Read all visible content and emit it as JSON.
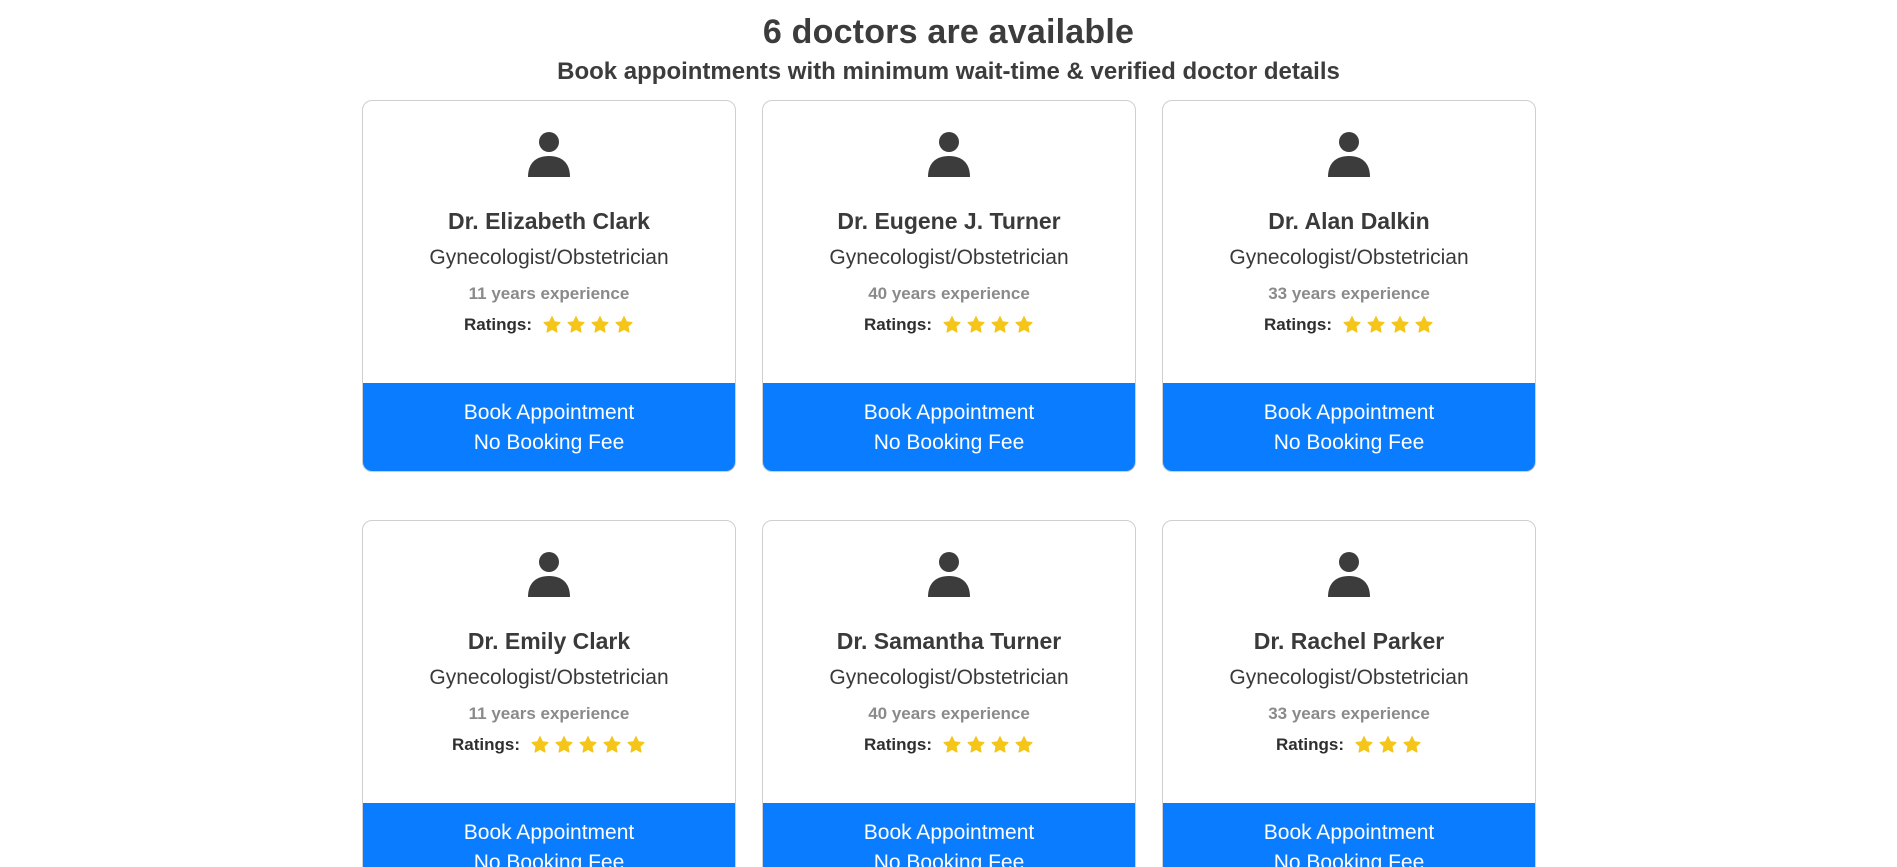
{
  "header": {
    "title": "6 doctors are available",
    "subtitle": "Book appointments with minimum wait-time & verified doctor details"
  },
  "colors": {
    "accent": "#0a7cff",
    "star": "#f5c518",
    "avatar": "#3c3c3c"
  },
  "rating_label": "Ratings:",
  "button": {
    "line1": "Book Appointment",
    "line2": "No Booking Fee"
  },
  "doctors": [
    {
      "name": "Dr. Elizabeth Clark",
      "specialty": "Gynecologist/Obstetrician",
      "experience": "11 years experience",
      "rating": 4
    },
    {
      "name": "Dr. Eugene J. Turner",
      "specialty": "Gynecologist/Obstetrician",
      "experience": "40 years experience",
      "rating": 4
    },
    {
      "name": "Dr. Alan Dalkin",
      "specialty": "Gynecologist/Obstetrician",
      "experience": "33 years experience",
      "rating": 4
    },
    {
      "name": "Dr. Emily Clark",
      "specialty": "Gynecologist/Obstetrician",
      "experience": "11 years experience",
      "rating": 5
    },
    {
      "name": "Dr. Samantha Turner",
      "specialty": "Gynecologist/Obstetrician",
      "experience": "40 years experience",
      "rating": 4
    },
    {
      "name": "Dr. Rachel Parker",
      "specialty": "Gynecologist/Obstetrician",
      "experience": "33 years experience",
      "rating": 3
    }
  ]
}
